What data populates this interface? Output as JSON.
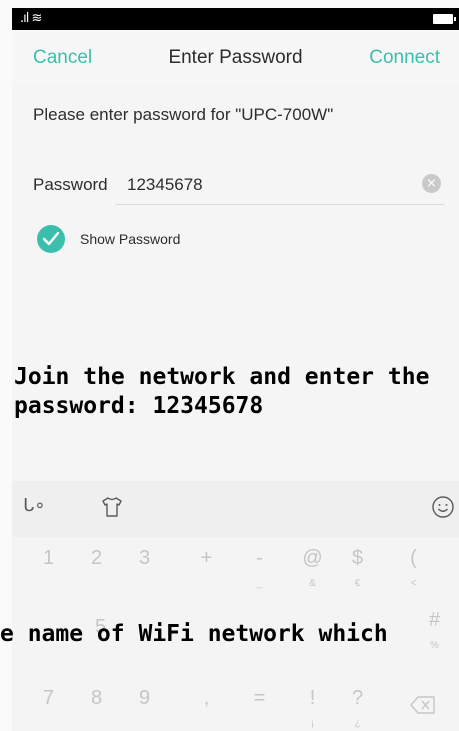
{
  "status_bar": {
    "signal": ".ıl",
    "wifi": "wifi-icon",
    "battery": "battery-icon"
  },
  "header": {
    "cancel_label": "Cancel",
    "title": "Enter Password",
    "connect_label": "Connect"
  },
  "prompt": "Please enter password for \"UPC-700W\"",
  "password": {
    "label": "Password",
    "value": "12345678",
    "clear_icon": "clear-icon"
  },
  "show_password": {
    "label": "Show Password",
    "checked": true
  },
  "caption_top": [
    "Join the network and enter the",
    "password: 12345678"
  ],
  "caption_bottom": "e name of WiFi network which",
  "keyboard": {
    "toolbar_left_icon": "handwriting-icon",
    "toolbar_mid_icon": "shirt-icon",
    "toolbar_right_icon": "emoji-icon",
    "row1": [
      {
        "k": "1",
        "s": ""
      },
      {
        "k": "2",
        "s": ""
      },
      {
        "k": "3",
        "s": ""
      },
      {
        "k": "+",
        "s": ""
      },
      {
        "k": "-",
        "s": "_"
      },
      {
        "k": "@",
        "s": "&"
      },
      {
        "k": "$",
        "s": "€"
      },
      {
        "k": "(",
        "s": "<"
      },
      {
        "k": ")",
        "s": ">"
      }
    ],
    "row3": [
      {
        "k": "7",
        "s": ""
      },
      {
        "k": "8",
        "s": ""
      },
      {
        "k": "9",
        "s": ""
      },
      {
        "k": ",",
        "s": ""
      },
      {
        "k": "=",
        "s": ""
      },
      {
        "k": "!",
        "s": "¡"
      },
      {
        "k": "?",
        "s": "¿"
      }
    ],
    "row2_visible_key": "5",
    "row2_right_key": "#",
    "row2_right_sub": "%",
    "delete_icon": "backspace-icon"
  }
}
